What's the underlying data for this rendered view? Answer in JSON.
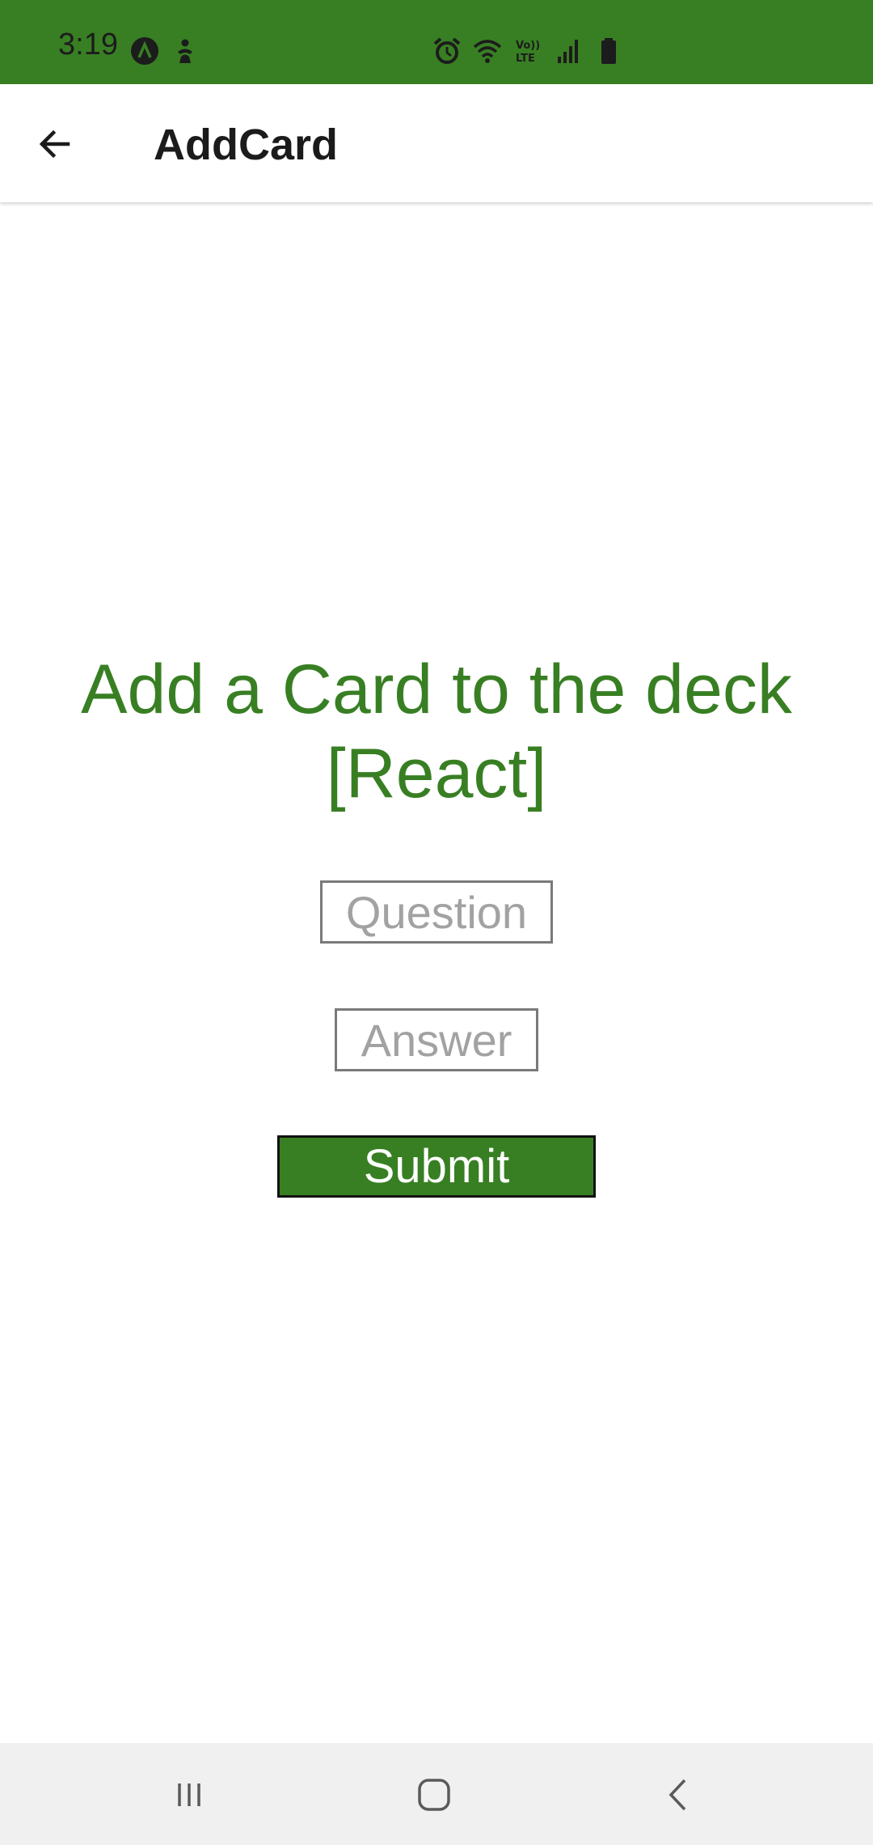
{
  "status_bar": {
    "time": "3:19",
    "background_color": "#387f23",
    "left_icons": [
      "app-notification-icon",
      "accessibility-icon"
    ],
    "right_icons": [
      "alarm-icon",
      "wifi-icon",
      "volte-icon",
      "signal-icon",
      "battery-icon"
    ]
  },
  "app_bar": {
    "back_icon": "arrow-left-icon",
    "title": "AddCard"
  },
  "main": {
    "heading": "Add a Card to the deck [React]",
    "question_placeholder": "Question",
    "question_value": "",
    "answer_placeholder": "Answer",
    "answer_value": "",
    "submit_label": "Submit",
    "accent_color": "#387f23"
  },
  "nav_bar": {
    "buttons": [
      "recents-icon",
      "home-icon",
      "back-icon"
    ]
  }
}
